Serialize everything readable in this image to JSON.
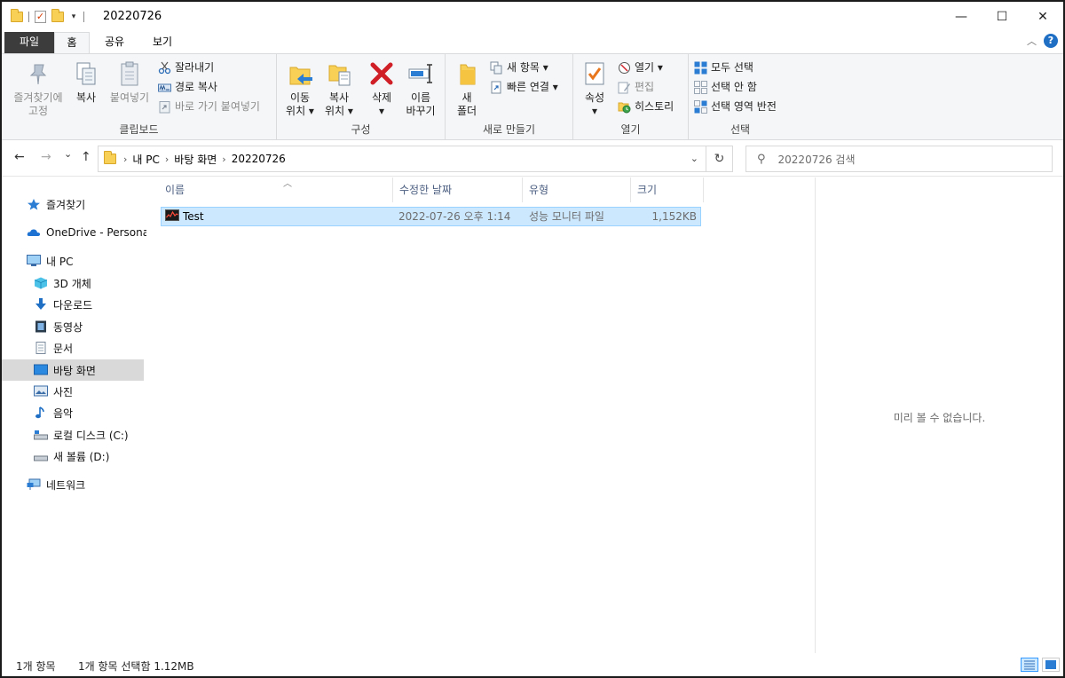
{
  "window": {
    "title": "20220726",
    "controls": {
      "minimize": "—",
      "maximize": "☐",
      "close": "✕"
    }
  },
  "tabs": [
    {
      "label": "파일"
    },
    {
      "label": "홈"
    },
    {
      "label": "공유"
    },
    {
      "label": "보기"
    }
  ],
  "ribbon": {
    "clipboard": {
      "label": "클립보드",
      "pin_line1": "즐겨찾기에",
      "pin_line2": "고정",
      "copy": "복사",
      "paste": "붙여넣기",
      "cut": "잘라내기",
      "copy_path": "경로 복사",
      "paste_shortcut": "바로 가기 붙여넣기"
    },
    "organize": {
      "label": "구성",
      "move_line1": "이동",
      "move_line2": "위치 ▾",
      "copy_line1": "복사",
      "copy_line2": "위치 ▾",
      "delete_line1": "삭제",
      "delete_line2": "▾",
      "rename_line1": "이름",
      "rename_line2": "바꾸기"
    },
    "new": {
      "label": "새로 만들기",
      "folder_line1": "새",
      "folder_line2": "폴더",
      "new_item": "새 항목 ▾",
      "easy_access": "빠른 연결 ▾"
    },
    "open": {
      "label": "열기",
      "properties_line1": "속성",
      "properties_line2": "▾",
      "open": "열기 ▾",
      "edit": "편집",
      "history": "히스토리"
    },
    "select": {
      "label": "선택",
      "select_all": "모두 선택",
      "select_none": "선택 안 함",
      "invert": "선택 영역 반전"
    }
  },
  "navigation": {
    "back": "←",
    "forward": "→",
    "recent": "⌄",
    "up": "↑",
    "breadcrumb": [
      "내 PC",
      "바탕 화면",
      "20220726"
    ],
    "refresh": "↻",
    "search_placeholder": "20220726 검색"
  },
  "sidebar": {
    "items": [
      {
        "label": "즐겨찾기",
        "icon": "star-icon"
      },
      {
        "label": "OneDrive - Personal",
        "icon": "cloud-icon"
      },
      {
        "label": "내 PC",
        "icon": "computer-icon"
      },
      {
        "label": "3D 개체",
        "icon": "cube-icon"
      },
      {
        "label": "다운로드",
        "icon": "download-icon"
      },
      {
        "label": "동영상",
        "icon": "video-icon"
      },
      {
        "label": "문서",
        "icon": "document-icon"
      },
      {
        "label": "바탕 화면",
        "icon": "desktop-icon",
        "selected": true
      },
      {
        "label": "사진",
        "icon": "picture-icon"
      },
      {
        "label": "음악",
        "icon": "music-icon"
      },
      {
        "label": "로컬 디스크 (C:)",
        "icon": "drive-icon"
      },
      {
        "label": "새 볼륨 (D:)",
        "icon": "drive-icon"
      },
      {
        "label": "네트워크",
        "icon": "network-icon"
      }
    ]
  },
  "file_list": {
    "columns": [
      "이름",
      "수정한 날짜",
      "유형",
      "크기"
    ],
    "rows": [
      {
        "name": "Test",
        "modified": "2022-07-26 오후 1:14",
        "type": "성능 모니터 파일",
        "size": "1,152KB",
        "icon": "perfmon-file-icon",
        "selected": true
      }
    ]
  },
  "preview": {
    "message": "미리 볼 수 없습니다."
  },
  "status": {
    "item_count": "1개 항목",
    "selection": "1개 항목 선택함 1.12MB"
  },
  "colors": {
    "selection_bg": "#cce8ff",
    "selection_border": "#99d1ff",
    "file_tab_bg": "#3c3c3c",
    "ribbon_bg": "#f5f6f7",
    "accent_blue": "#1f6fc5"
  }
}
